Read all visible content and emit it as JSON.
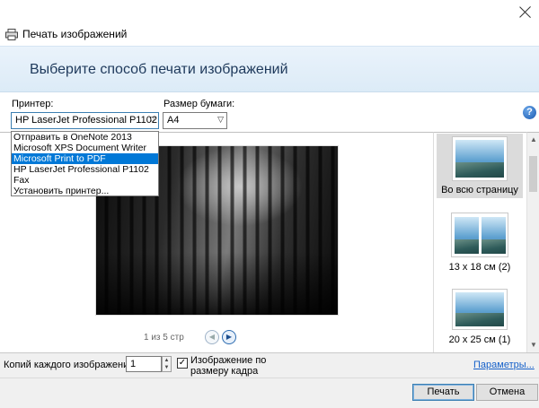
{
  "window": {
    "app_title": "Печать изображений"
  },
  "header": {
    "title": "Выберите способ печати изображений"
  },
  "printer": {
    "label": "Принтер:",
    "selected": "HP LaserJet Professional P1102",
    "options": [
      "Отправить в OneNote 2013",
      "Microsoft XPS Document Writer",
      "Microsoft Print to PDF",
      "HP LaserJet Professional P1102",
      "Fax",
      "Установить принтер..."
    ],
    "highlighted_index": 2
  },
  "paper": {
    "label": "Размер бумаги:",
    "selected": "A4"
  },
  "help": {
    "glyph": "?"
  },
  "preview": {
    "pager": "1 из 5 стр",
    "prev_glyph": "◀",
    "next_glyph": "▶"
  },
  "layouts": [
    {
      "label": "Во всю страницу",
      "selected": true
    },
    {
      "label": "13 x 18 см (2)",
      "selected": false
    },
    {
      "label": "20 x 25 см (1)",
      "selected": false
    }
  ],
  "copies": {
    "label": "Копий каждого изображения:",
    "value": "1"
  },
  "fit": {
    "checked": true,
    "label": "Изображение по размеру кадра"
  },
  "links": {
    "parameters": "Параметры..."
  },
  "buttons": {
    "print": "Печать",
    "cancel": "Отмена"
  },
  "icons": {
    "close": "close-icon",
    "printer": "printer-icon",
    "help": "help-icon"
  },
  "colors": {
    "accent": "#0078d7",
    "header_bg": "#dcebf7",
    "link": "#1560c9"
  }
}
